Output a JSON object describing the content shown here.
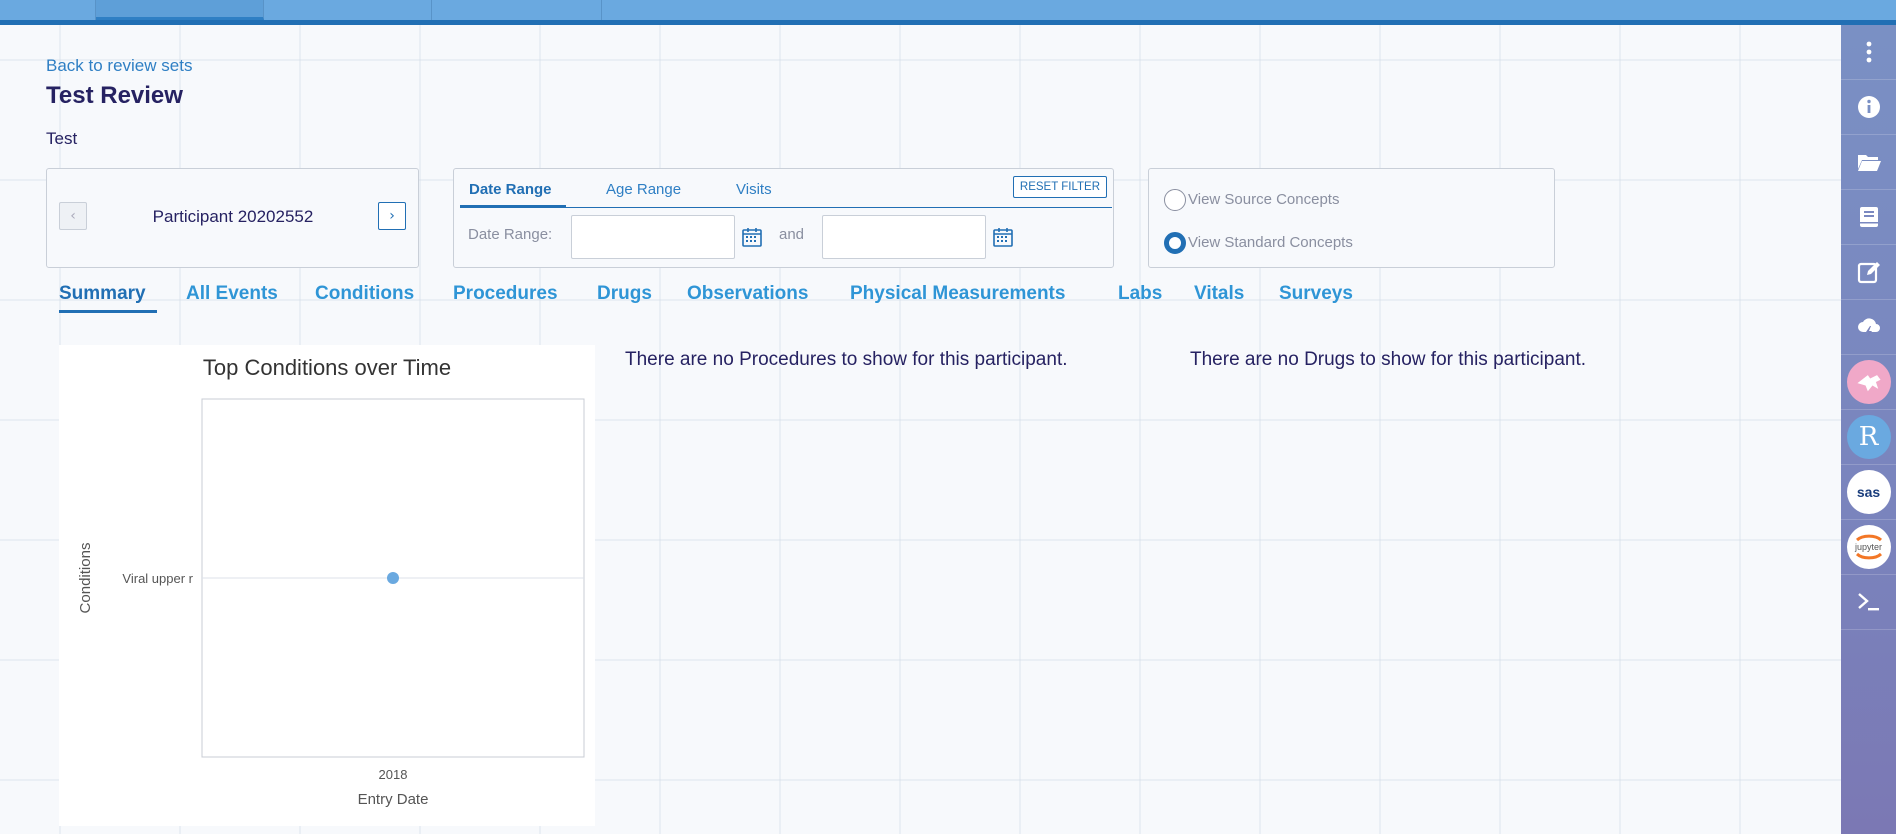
{
  "header": {
    "back_link": "Back to review sets",
    "title": "Test Review",
    "description": "Test"
  },
  "participant_nav": {
    "label": "Participant 20202552",
    "prev_icon": "chevron-left-icon",
    "next_icon": "chevron-right-icon"
  },
  "filter": {
    "tabs": [
      "Date Range",
      "Age Range",
      "Visits"
    ],
    "active_tab": "Date Range",
    "reset_label": "RESET FILTER",
    "date_range_label": "Date Range:",
    "and_label": "and",
    "start_value": "",
    "end_value": ""
  },
  "concepts": {
    "options": [
      "View Source Concepts",
      "View Standard Concepts"
    ],
    "selected": "View Standard Concepts"
  },
  "main_tabs": [
    "Summary",
    "All Events",
    "Conditions",
    "Procedures",
    "Drugs",
    "Observations",
    "Physical Measurements",
    "Labs",
    "Vitals",
    "Surveys"
  ],
  "active_main_tab": "Summary",
  "messages": {
    "procedures_empty": "There are no Procedures to show for this participant.",
    "drugs_empty": "There are no Drugs to show for this participant."
  },
  "sidebar": {
    "icons": [
      "more-vertical-icon",
      "info-icon",
      "folder-open-icon",
      "book-icon",
      "edit-icon",
      "cloud-lightning-icon",
      "cromwell-icon",
      "rstudio-icon",
      "sas-icon",
      "jupyter-icon",
      "terminal-icon"
    ],
    "r_letter": "R",
    "sas_text": "sas",
    "jupyter_text": "jupyter"
  },
  "colors": {
    "accent": "#216fb4",
    "link": "#2f95d6",
    "point": "#6aa9e0",
    "sidebar": "#7a84bd"
  },
  "chart_data": {
    "type": "scatter",
    "title": "Top Conditions over Time",
    "xlabel": "Entry Date",
    "ylabel": "Conditions",
    "x_ticks": [
      "2018"
    ],
    "y_categories": [
      "Viral upper r"
    ],
    "points": [
      {
        "x": "2018",
        "y": "Viral upper r"
      }
    ],
    "grid": true
  }
}
